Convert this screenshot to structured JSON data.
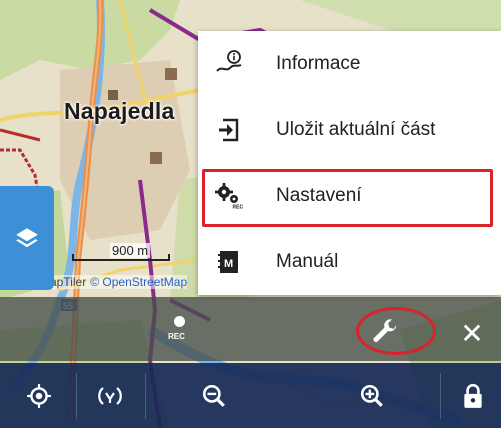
{
  "map": {
    "city_label": "Napajedla",
    "scale_label": "900 m",
    "attribution_prefix": "MapTiler",
    "attribution_link": "© OpenStreetMap",
    "road_number": "55"
  },
  "menu": {
    "items": [
      {
        "label": "Informace",
        "icon": "info-route-icon"
      },
      {
        "label": "Uložit aktuální část",
        "icon": "save-export-icon"
      },
      {
        "label": "Nastavení",
        "icon": "settings-gear-icon"
      },
      {
        "label": "Manuál",
        "icon": "manual-book-icon"
      }
    ]
  },
  "toolbar": {
    "rec_label": "REC",
    "close_symbol": "✕"
  },
  "colors": {
    "highlight": "#d9232b",
    "layers_button": "#3d8fd6",
    "bottom_bar": "#162956"
  }
}
